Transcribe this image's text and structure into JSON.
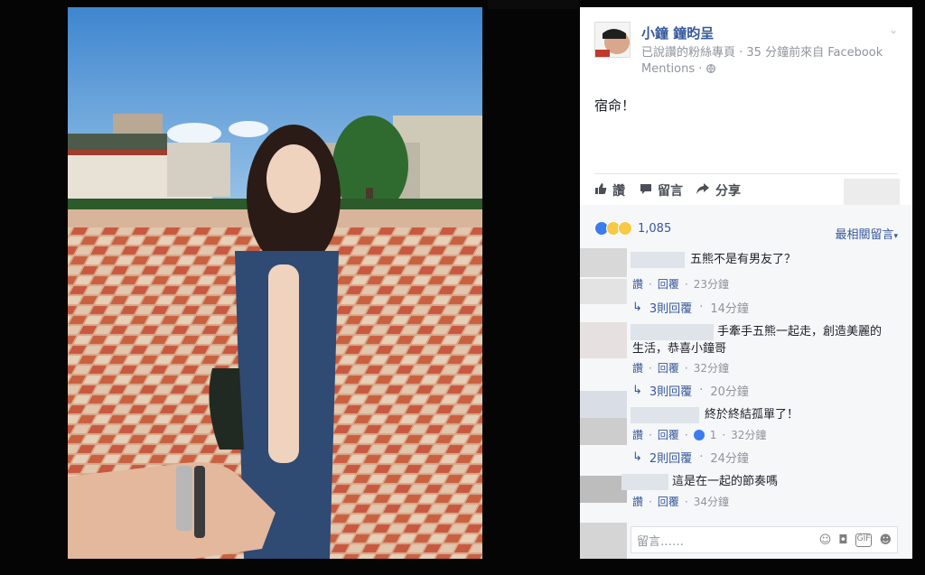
{
  "header": {
    "page_name": "小鐘 鐘昀呈",
    "meta_line1": "已說讚的粉絲專頁 · 35 分鐘前來自 Facebook",
    "meta_line2": "Mentions · ",
    "globe_icon": "globe-icon"
  },
  "post": {
    "text": "宿命！"
  },
  "actions": {
    "like_label": "讚",
    "comment_label": "留言",
    "share_label": "分享"
  },
  "reactions": {
    "count": "1,085",
    "sort_label": "最相關留言"
  },
  "comments": [
    {
      "text": "五熊不是有男友了？",
      "like_label": "讚",
      "reply_label": "回覆",
      "time": "23分鐘",
      "replies": {
        "label": "3則回覆",
        "time": "14分鐘"
      }
    },
    {
      "text_line1": "手牽手五熊一起走，創造美麗的",
      "text_line2": "生活，恭喜小鐘哥",
      "like_label": "讚",
      "reply_label": "回覆",
      "time": "32分鐘",
      "replies": {
        "label": "3則回覆",
        "time": "20分鐘"
      }
    },
    {
      "text": "終於終結孤單了！",
      "like_label": "讚",
      "reply_label": "回覆",
      "like_count": "1",
      "time": "32分鐘",
      "replies": {
        "label": "2則回覆",
        "time": "24分鐘"
      }
    },
    {
      "text": "這是在一起的節奏嗎",
      "like_label": "讚",
      "reply_label": "回覆",
      "time": "34分鐘"
    }
  ],
  "comment_input": {
    "placeholder": "留言……"
  },
  "colors": {
    "link": "#365899",
    "muted": "#90949c",
    "panel_bg": "#f6f7f9"
  }
}
